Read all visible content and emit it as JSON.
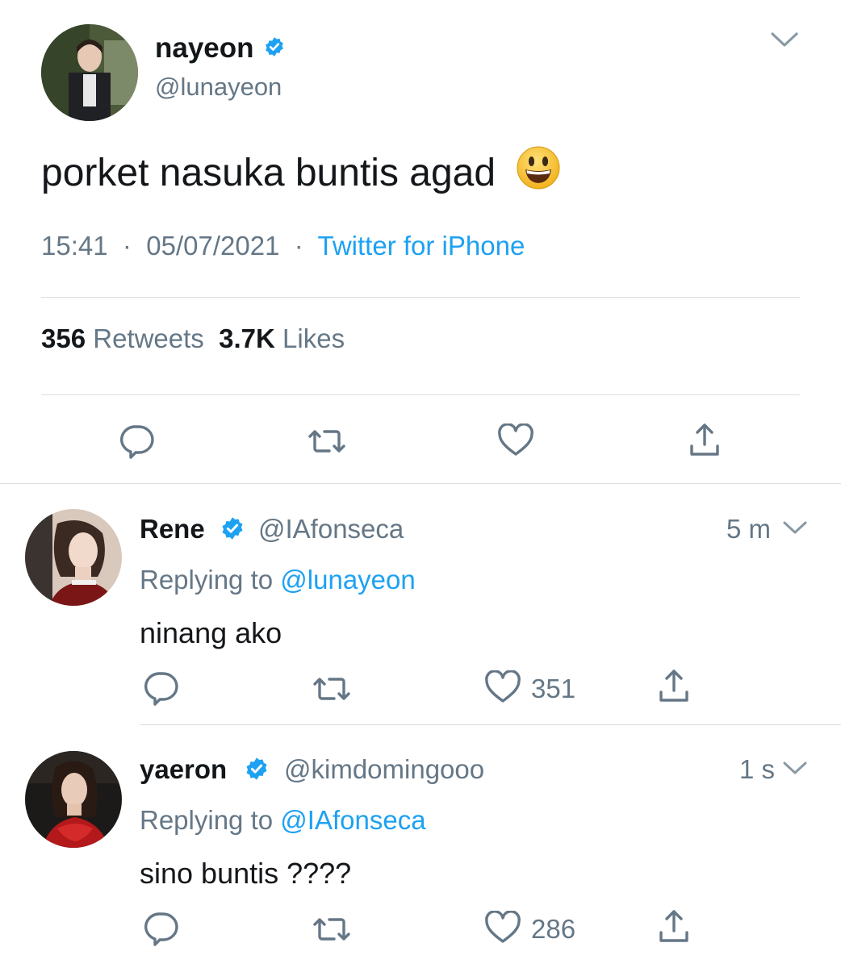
{
  "tweet": {
    "name": "nayeon",
    "handle": "@lunayeon",
    "text": "porket nasuka buntis agad",
    "emoji": "😃",
    "time": "15:41",
    "date": "05/07/2021",
    "source": "Twitter for iPhone",
    "retweet_count": "356",
    "retweet_label": "Retweets",
    "like_count": "3.7K",
    "like_label": "Likes"
  },
  "replies": [
    {
      "name": "Rene",
      "handle": "@IAfonseca",
      "time": "5 m",
      "replying_prefix": "Replying to",
      "replying_to": "@lunayeon",
      "text": "ninang ako",
      "likes": "351"
    },
    {
      "name": "yaeron",
      "handle": "@kimdomingooo",
      "time": "1 s",
      "replying_prefix": "Replying to",
      "replying_to": "@IAfonseca",
      "text": "sino buntis ????",
      "likes": "286"
    }
  ],
  "colors": {
    "text": "#14171a",
    "secondary": "#657786",
    "link": "#1da1f2",
    "divider": "#d8dde1",
    "verified": "#1da1f2"
  },
  "icons": [
    "chevron-down-icon",
    "verified-badge-icon",
    "reply-icon",
    "retweet-icon",
    "like-icon",
    "share-icon"
  ]
}
